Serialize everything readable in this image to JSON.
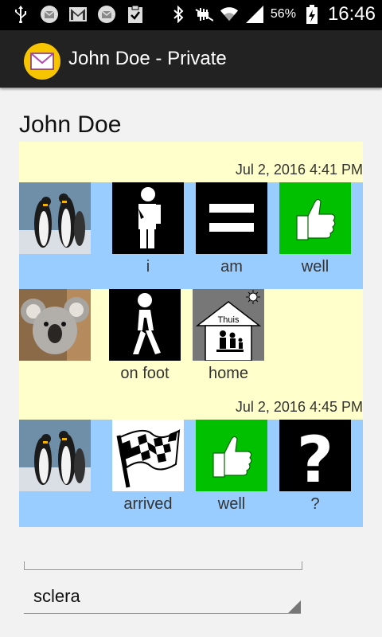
{
  "status_bar": {
    "battery": "56%",
    "time": "16:46"
  },
  "action_bar": {
    "title": "John Doe - Private"
  },
  "contact": {
    "name": "John Doe"
  },
  "messages": [
    {
      "timestamp": "Jul 2, 2016 4:41 PM",
      "pictos": [
        {
          "label": "i",
          "icon": "person-icon"
        },
        {
          "label": "am",
          "icon": "equals-icon"
        },
        {
          "label": "well",
          "icon": "thumbs-up-icon"
        }
      ]
    },
    {
      "timestamp": "",
      "pictos": [
        {
          "label": "on foot",
          "icon": "walking-person-icon"
        },
        {
          "label": "home",
          "icon": "home-icon",
          "inner_text": "Thuis"
        }
      ]
    },
    {
      "timestamp": "Jul 2, 2016 4:45 PM",
      "pictos": [
        {
          "label": "arrived",
          "icon": "checkered-flag-icon"
        },
        {
          "label": "well",
          "icon": "thumbs-up-icon"
        },
        {
          "label": "?",
          "icon": "question-mark-icon"
        }
      ]
    }
  ],
  "input": {
    "value": ""
  },
  "select": {
    "value": "sclera"
  },
  "colors": {
    "yellow_bubble": "#ffffcc",
    "blue_bubble": "#99ccff",
    "thumbs_green": "#00c000"
  }
}
